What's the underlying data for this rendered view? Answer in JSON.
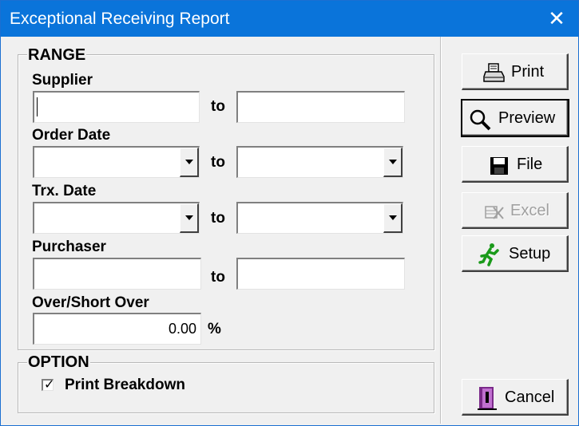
{
  "window": {
    "title": "Exceptional Receiving Report",
    "close_glyph": "✕"
  },
  "range": {
    "legend": "RANGE",
    "supplier": {
      "label": "Supplier",
      "from_value": "",
      "to_value": ""
    },
    "order_date": {
      "label": "Order Date",
      "from_value": "",
      "to_value": ""
    },
    "trx_date": {
      "label": "Trx. Date",
      "from_value": "",
      "to_value": ""
    },
    "purchaser": {
      "label": "Purchaser",
      "from_value": "",
      "to_value": ""
    },
    "over_short": {
      "label": "Over/Short Over",
      "value": "0.00",
      "unit": "%"
    },
    "to_label": "to"
  },
  "option": {
    "legend": "OPTION",
    "print_breakdown": {
      "label": "Print Breakdown",
      "checked": true,
      "mark": "✓"
    }
  },
  "buttons": {
    "print": {
      "label": "Print",
      "icon": "printer-icon"
    },
    "preview": {
      "label": "Preview",
      "icon": "magnifier-icon"
    },
    "file": {
      "label": "File",
      "icon": "floppy-disk-icon"
    },
    "excel": {
      "label": "Excel",
      "icon": "excel-icon",
      "disabled": true
    },
    "setup": {
      "label": "Setup",
      "icon": "running-man-icon"
    },
    "cancel": {
      "label": "Cancel",
      "icon": "door-exit-icon"
    }
  },
  "colors": {
    "titlebar": "#0a74da",
    "dialog_bg": "#f0f0f0"
  }
}
